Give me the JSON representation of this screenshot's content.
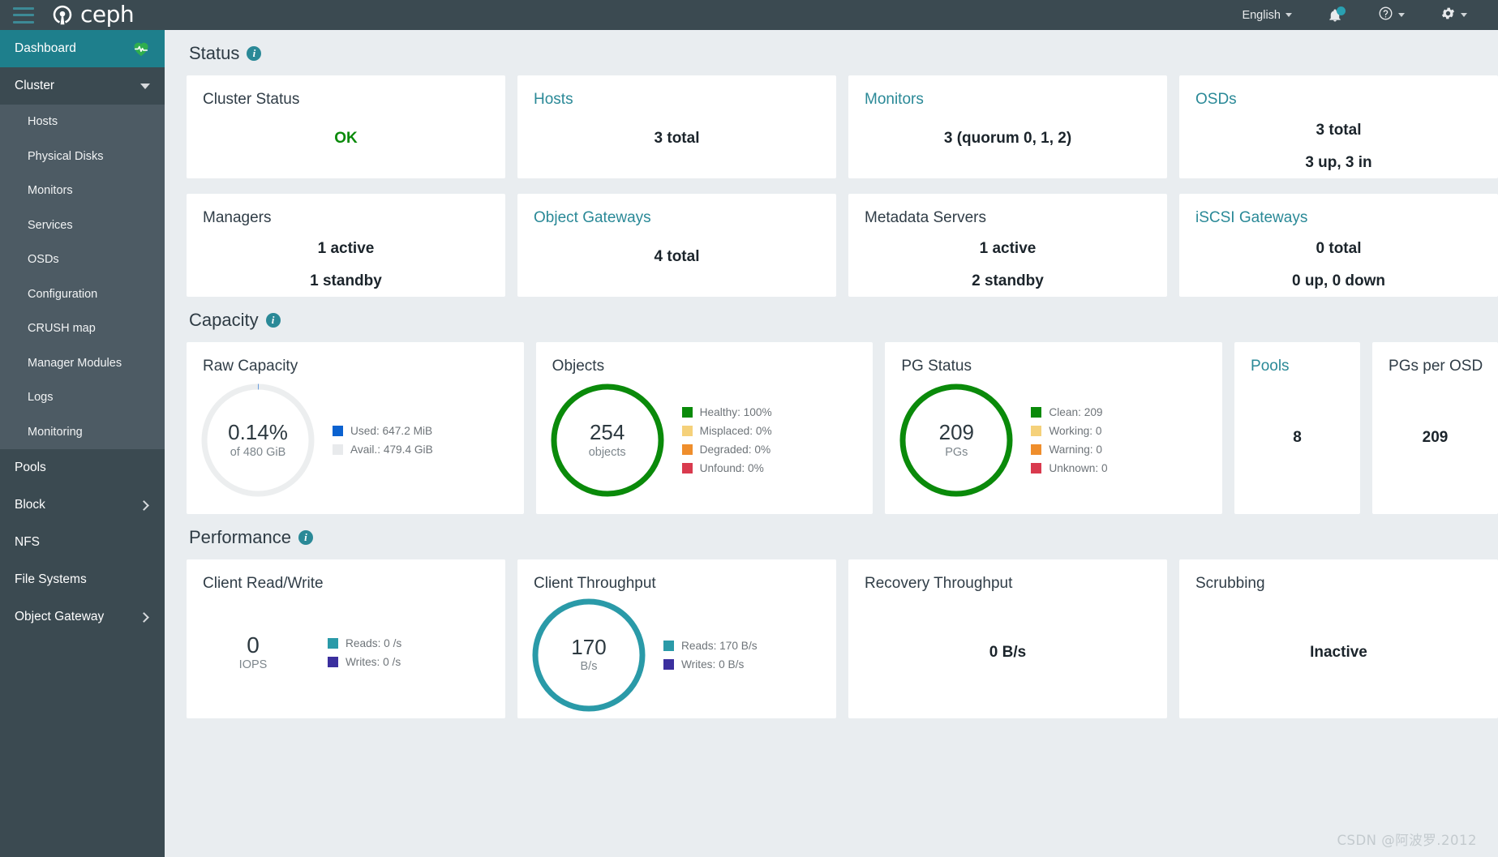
{
  "colors": {
    "brand_dark": "#3b4a51",
    "teal": "#2a8997",
    "active_nav": "#1e7f8c",
    "green": "#0a8a0a",
    "yellow": "#f5d17a",
    "orange": "#ef8e2c",
    "red": "#d93a4e",
    "blue": "#0b62d0",
    "gray": "#e4e6e8",
    "purple": "#3b2f9e"
  },
  "topbar": {
    "brand": "ceph",
    "menu_icon": "hamburger-icon",
    "language": "English",
    "notification_icon": "bell-icon",
    "help_icon": "question-circle-icon",
    "settings_icon": "gear-icon"
  },
  "sidebar": {
    "items": [
      {
        "label": "Dashboard",
        "icon": "heart-pulse-icon",
        "active": true,
        "expandable": false
      },
      {
        "label": "Cluster",
        "icon": "chevron-down-icon",
        "active": false,
        "expandable": true,
        "children": [
          {
            "label": "Hosts"
          },
          {
            "label": "Physical Disks"
          },
          {
            "label": "Monitors"
          },
          {
            "label": "Services"
          },
          {
            "label": "OSDs"
          },
          {
            "label": "Configuration"
          },
          {
            "label": "CRUSH map"
          },
          {
            "label": "Manager Modules"
          },
          {
            "label": "Logs"
          },
          {
            "label": "Monitoring"
          }
        ]
      },
      {
        "label": "Pools",
        "icon": "",
        "active": false,
        "expandable": false
      },
      {
        "label": "Block",
        "icon": "chevron-right-icon",
        "active": false,
        "expandable": true
      },
      {
        "label": "NFS",
        "icon": "",
        "active": false,
        "expandable": false
      },
      {
        "label": "File Systems",
        "icon": "",
        "active": false,
        "expandable": false
      },
      {
        "label": "Object Gateway",
        "icon": "chevron-right-icon",
        "active": false,
        "expandable": true
      }
    ]
  },
  "status": {
    "heading": "Status",
    "cards": [
      {
        "title": "Cluster Status",
        "is_link": false,
        "lines": [
          "OK"
        ],
        "state": "ok"
      },
      {
        "title": "Hosts",
        "is_link": true,
        "lines": [
          "3 total"
        ],
        "state": ""
      },
      {
        "title": "Monitors",
        "is_link": true,
        "lines": [
          "3 (quorum 0, 1, 2)"
        ],
        "state": ""
      },
      {
        "title": "OSDs",
        "is_link": true,
        "lines": [
          "3 total",
          "3 up, 3 in"
        ],
        "state": ""
      },
      {
        "title": "Managers",
        "is_link": false,
        "lines": [
          "1 active",
          "1 standby"
        ],
        "state": ""
      },
      {
        "title": "Object Gateways",
        "is_link": true,
        "lines": [
          "4 total"
        ],
        "state": ""
      },
      {
        "title": "Metadata Servers",
        "is_link": false,
        "lines": [
          "1 active",
          "2 standby"
        ],
        "state": ""
      },
      {
        "title": "iSCSI Gateways",
        "is_link": true,
        "lines": [
          "0 total",
          "0 up, 0 down"
        ],
        "state": ""
      }
    ]
  },
  "capacity": {
    "heading": "Capacity",
    "raw": {
      "title": "Raw Capacity",
      "percent_label": "0.14%",
      "of_label": "of 480 GiB",
      "percent_value": 0.14,
      "ring_color": "#e4e6e8",
      "legend": [
        {
          "label": "Used: 647.2 MiB",
          "color": "#0b62d0"
        },
        {
          "label": "Avail.: 479.4 GiB",
          "color": "#e8eaec"
        }
      ]
    },
    "objects": {
      "title": "Objects",
      "center_value": "254",
      "center_unit": "objects",
      "ring_color": "#0a8a0a",
      "legend": [
        {
          "label": "Healthy: 100%",
          "color": "#0a8a0a"
        },
        {
          "label": "Misplaced: 0%",
          "color": "#f5d17a"
        },
        {
          "label": "Degraded: 0%",
          "color": "#ef8e2c"
        },
        {
          "label": "Unfound: 0%",
          "color": "#d93a4e"
        }
      ]
    },
    "pg_status": {
      "title": "PG Status",
      "center_value": "209",
      "center_unit": "PGs",
      "ring_color": "#0a8a0a",
      "legend": [
        {
          "label": "Clean: 209",
          "color": "#0a8a0a"
        },
        {
          "label": "Working: 0",
          "color": "#f5d17a"
        },
        {
          "label": "Warning: 0",
          "color": "#ef8e2c"
        },
        {
          "label": "Unknown: 0",
          "color": "#d93a4e"
        }
      ]
    },
    "pools": {
      "title": "Pools",
      "is_link": true,
      "value": "8"
    },
    "pgs_per_osd": {
      "title": "PGs per OSD",
      "is_link": false,
      "value": "209"
    }
  },
  "performance": {
    "heading": "Performance",
    "client_rw": {
      "title": "Client Read/Write",
      "center_value": "0",
      "center_unit": "IOPS",
      "legend": [
        {
          "label": "Reads: 0 /s",
          "color": "#2a9aa8"
        },
        {
          "label": "Writes: 0 /s",
          "color": "#3b2f9e"
        }
      ]
    },
    "client_throughput": {
      "title": "Client Throughput",
      "center_value": "170",
      "center_unit": "B/s",
      "ring_color": "#2a9aa8",
      "legend": [
        {
          "label": "Reads: 170 B/s",
          "color": "#2a9aa8"
        },
        {
          "label": "Writes: 0 B/s",
          "color": "#3b2f9e"
        }
      ]
    },
    "recovery_throughput": {
      "title": "Recovery Throughput",
      "value": "0 B/s"
    },
    "scrubbing": {
      "title": "Scrubbing",
      "value": "Inactive"
    }
  },
  "watermark": "CSDN @阿波罗.2012"
}
